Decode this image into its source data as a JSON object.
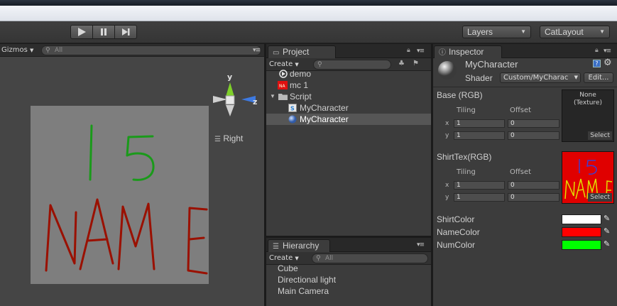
{
  "toolbar": {
    "layers_label": "Layers",
    "layout_label": "CatLayout"
  },
  "scene": {
    "gizmos_label": "Gizmos",
    "search_placeholder": "All",
    "view_label": "Right",
    "axis_y": "y",
    "axis_z": "z",
    "canvas_number": "15",
    "canvas_name": "NAME"
  },
  "project": {
    "tab_label": "Project",
    "create_label": "Create",
    "items": [
      {
        "label": "demo",
        "icon": "unity-scene-icon"
      },
      {
        "label": "mc 1",
        "icon": "texture-icon"
      },
      {
        "label": "Script",
        "icon": "folder-icon"
      },
      {
        "label": "MyCharacter",
        "icon": "shader-script-icon"
      },
      {
        "label": "MyCharacter",
        "icon": "material-sphere-icon"
      }
    ]
  },
  "hierarchy": {
    "tab_label": "Hierarchy",
    "create_label": "Create",
    "search_placeholder": "All",
    "items": [
      "Cube",
      "Directional light",
      "Main Camera"
    ]
  },
  "inspector": {
    "tab_label": "Inspector",
    "object_name": "MyCharacter",
    "shader_label": "Shader",
    "shader_value": "Custom/MyCharac",
    "edit_label": "Edit...",
    "base_label": "Base (RGB)",
    "shirttex_label": "ShirtTex(RGB)",
    "tiling_label": "Tiling",
    "offset_label": "Offset",
    "x_label": "x",
    "y_label": "y",
    "base_tiling_x": "1",
    "base_offset_x": "0",
    "base_tiling_y": "1",
    "base_offset_y": "0",
    "shirt_tiling_x": "1",
    "shirt_offset_x": "0",
    "shirt_tiling_y": "1",
    "shirt_offset_y": "0",
    "none_texture_line1": "None",
    "none_texture_line2": "(Texture)",
    "select_label": "Select",
    "shirtcolor_label": "ShirtColor",
    "namecolor_label": "NameColor",
    "numcolor_label": "NumColor",
    "shirtcolor_value": "#ffffff",
    "namecolor_value": "#ff0000",
    "numcolor_value": "#00ff00",
    "thumb_number": "15",
    "thumb_name": "NAME"
  }
}
